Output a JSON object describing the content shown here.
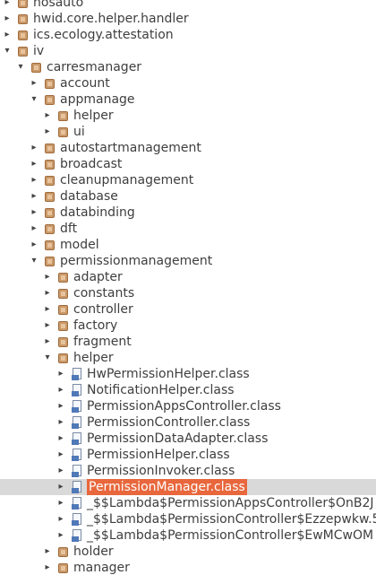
{
  "tree": {
    "rows": [
      {
        "label": "hosauto",
        "type": "package",
        "state": "collapsed"
      },
      {
        "label": "hwid.core.helper.handler",
        "type": "package",
        "state": "collapsed"
      },
      {
        "label": "ics.ecology.attestation",
        "type": "package",
        "state": "collapsed"
      },
      {
        "label": "iv",
        "type": "package",
        "state": "expanded"
      },
      {
        "label": "carresmanager",
        "type": "package",
        "state": "expanded"
      },
      {
        "label": "account",
        "type": "package",
        "state": "collapsed"
      },
      {
        "label": "appmanage",
        "type": "package",
        "state": "expanded"
      },
      {
        "label": "helper",
        "type": "package",
        "state": "collapsed"
      },
      {
        "label": "ui",
        "type": "package",
        "state": "collapsed"
      },
      {
        "label": "autostartmanagement",
        "type": "package",
        "state": "collapsed"
      },
      {
        "label": "broadcast",
        "type": "package",
        "state": "collapsed"
      },
      {
        "label": "cleanupmanagement",
        "type": "package",
        "state": "collapsed"
      },
      {
        "label": "database",
        "type": "package",
        "state": "collapsed"
      },
      {
        "label": "databinding",
        "type": "package",
        "state": "collapsed"
      },
      {
        "label": "dft",
        "type": "package",
        "state": "collapsed"
      },
      {
        "label": "model",
        "type": "package",
        "state": "collapsed"
      },
      {
        "label": "permissionmanagement",
        "type": "package",
        "state": "expanded"
      },
      {
        "label": "adapter",
        "type": "package",
        "state": "collapsed"
      },
      {
        "label": "constants",
        "type": "package",
        "state": "collapsed"
      },
      {
        "label": "controller",
        "type": "package",
        "state": "collapsed"
      },
      {
        "label": "factory",
        "type": "package",
        "state": "collapsed"
      },
      {
        "label": "fragment",
        "type": "package",
        "state": "collapsed"
      },
      {
        "label": "helper",
        "type": "package",
        "state": "expanded"
      },
      {
        "label": "HwPermissionHelper.class",
        "type": "class",
        "state": "collapsed"
      },
      {
        "label": "NotificationHelper.class",
        "type": "class",
        "state": "collapsed"
      },
      {
        "label": "PermissionAppsController.class",
        "type": "class",
        "state": "collapsed"
      },
      {
        "label": "PermissionController.class",
        "type": "class",
        "state": "collapsed"
      },
      {
        "label": "PermissionDataAdapter.class",
        "type": "class",
        "state": "collapsed"
      },
      {
        "label": "PermissionHelper.class",
        "type": "class",
        "state": "collapsed"
      },
      {
        "label": "PermissionInvoker.class",
        "type": "class",
        "state": "collapsed"
      },
      {
        "label": "PermissionManager.class",
        "type": "class",
        "state": "collapsed",
        "selected": true
      },
      {
        "label": "_$$Lambda$PermissionAppsController$OnB2J",
        "type": "class",
        "state": "collapsed"
      },
      {
        "label": "_$$Lambda$PermissionController$Ezzepwkw.5",
        "type": "class",
        "state": "collapsed"
      },
      {
        "label": "_$$Lambda$PermissionController$EwMCwOM",
        "type": "class",
        "state": "collapsed"
      },
      {
        "label": "holder",
        "type": "package",
        "state": "collapsed"
      },
      {
        "label": "manager",
        "type": "package",
        "state": "collapsed"
      }
    ]
  },
  "colors": {
    "selection_row": "#d9d9d9",
    "selection_label": "#e8673c",
    "package_icon": "#c99a6b",
    "class_icon": "#4f79b8"
  }
}
